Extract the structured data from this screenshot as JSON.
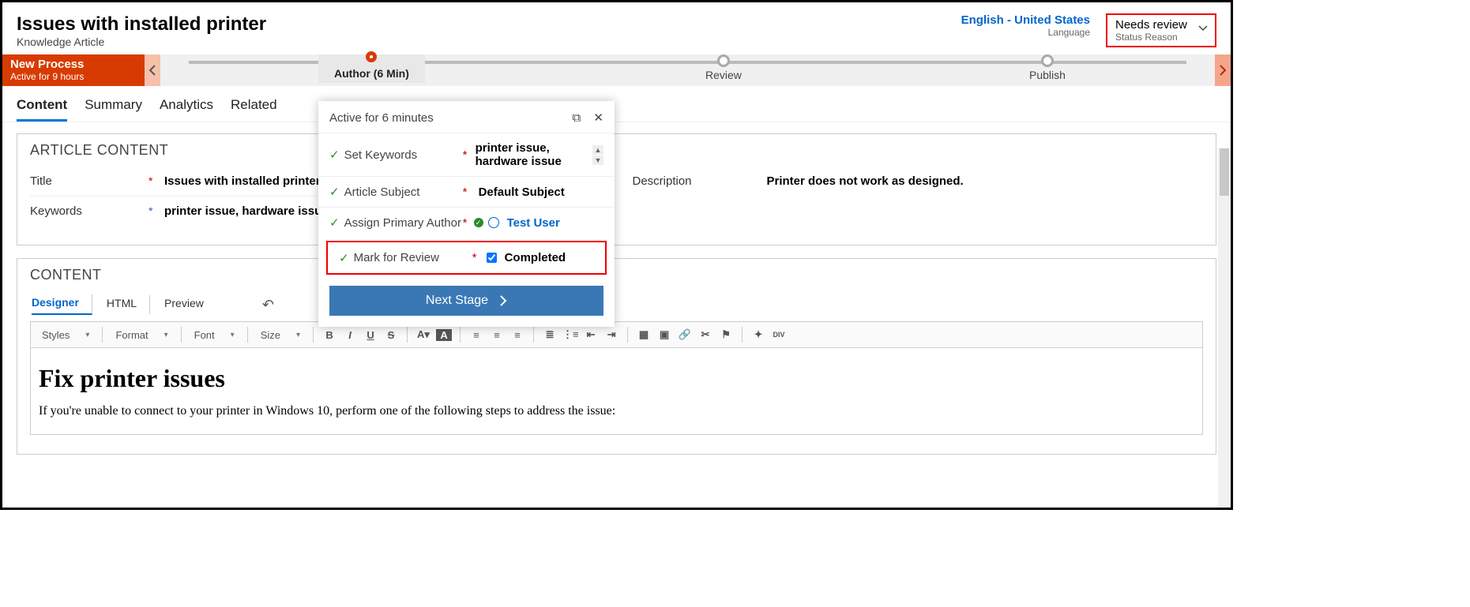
{
  "header": {
    "title": "Issues with installed printer",
    "subtitle": "Knowledge Article",
    "language_value": "English - United States",
    "language_label": "Language",
    "status_value": "Needs review",
    "status_label": "Status Reason"
  },
  "process": {
    "name": "New Process",
    "active_for": "Active for 9 hours",
    "stages": {
      "author": "Author",
      "author_time": "(6 Min)",
      "review": "Review",
      "publish": "Publish"
    }
  },
  "tabs": {
    "content": "Content",
    "summary": "Summary",
    "analytics": "Analytics",
    "related": "Related"
  },
  "article": {
    "section_title": "ARTICLE CONTENT",
    "title_label": "Title",
    "title_value": "Issues with installed printer",
    "keywords_label": "Keywords",
    "keywords_value": "printer issue, hardware issue",
    "description_label": "Description",
    "description_value": "Printer does not work as designed."
  },
  "popup": {
    "header": "Active for 6 minutes",
    "set_keywords_label": "Set Keywords",
    "set_keywords_value": "printer issue, hardware issue",
    "article_subject_label": "Article Subject",
    "article_subject_value": "Default Subject",
    "assign_author_label": "Assign Primary Author",
    "assign_author_value": "Test User",
    "mark_review_label": "Mark for Review",
    "mark_review_value": "Completed",
    "next_stage": "Next Stage"
  },
  "content": {
    "section_title": "CONTENT",
    "subtabs": {
      "designer": "Designer",
      "html": "HTML",
      "preview": "Preview"
    },
    "toolbar": {
      "styles": "Styles",
      "format": "Format",
      "font": "Font",
      "size": "Size"
    },
    "doc_heading": "Fix printer issues",
    "doc_para": "If you're unable to connect to your printer in Windows 10, perform one of the following steps to address the issue:"
  }
}
